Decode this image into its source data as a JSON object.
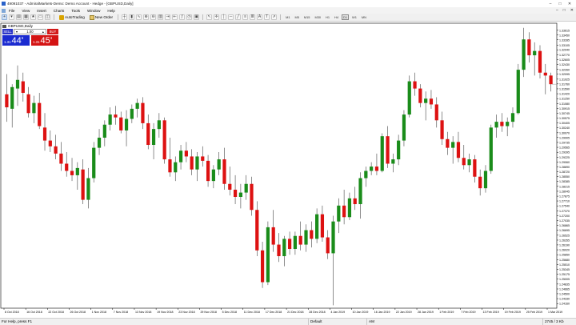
{
  "window": {
    "title": "49091037 - AdmiralMarkets-Demo: Demo Account - Hedge - [GBPUSD,Daily]",
    "controls": [
      "–",
      "□",
      "✕"
    ]
  },
  "menu": {
    "items": [
      "File",
      "View",
      "Insert",
      "Charts",
      "Tools",
      "Window",
      "Help"
    ],
    "right_controls": [
      "–",
      "□",
      "✕"
    ]
  },
  "toolbar": {
    "auto_trading_label": "AutoTrading",
    "new_order_label": "New Order",
    "timeframes": [
      "M1",
      "M5",
      "M15",
      "M30",
      "H1",
      "H4",
      "D1",
      "W1",
      "MN"
    ],
    "active_timeframe": "D1"
  },
  "chart": {
    "caption": "GBPUSD,Daily",
    "trade_panel": {
      "sell_label": "SELL",
      "buy_label": "BUY",
      "lot_value": "1.00",
      "sell_prefix": "1.31",
      "sell_big": "44",
      "sell_sup": "6",
      "buy_prefix": "1.31",
      "buy_big": "45",
      "buy_sup": "3"
    }
  },
  "chart_data": {
    "type": "candlestick",
    "symbol": "GBPUSD",
    "timeframe": "Daily",
    "ylim": [
      1.24,
      1.3386
    ],
    "price_labels": [
      "1.33615",
      "1.33450",
      "1.33285",
      "1.33105",
      "1.32940",
      "1.32770",
      "1.32605",
      "1.32430",
      "1.32260",
      "1.32095",
      "1.31925",
      "1.31760",
      "1.31590",
      "1.31420",
      "1.31250",
      "1.31080",
      "1.30915",
      "1.30745",
      "1.30575",
      "1.30405",
      "1.30240",
      "1.30070",
      "1.29905",
      "1.29735",
      "1.29565",
      "1.29395",
      "1.29225",
      "1.29060",
      "1.28890",
      "1.28720",
      "1.28550",
      "1.28385",
      "1.28215",
      "1.28045",
      "1.27875",
      "1.27710",
      "1.27540",
      "1.27370",
      "1.27200",
      "1.27035",
      "1.26865",
      "1.26695",
      "1.26525",
      "1.26355",
      "1.26190",
      "1.26020",
      "1.25850",
      "1.25680",
      "1.25510",
      "1.25345",
      "1.25175",
      "1.25005",
      "1.24835",
      "1.24665",
      "1.24500",
      "1.24330",
      "1.24160"
    ],
    "date_labels": [
      "8 Oct 2018",
      "16 Oct 2018",
      "22 Oct 2018",
      "26 Oct 2018",
      "1 Nov 2018",
      "7 Nov 2018",
      "13 Nov 2018",
      "19 Nov 2018",
      "23 Nov 2018",
      "29 Nov 2018",
      "5 Dec 2018",
      "11 Dec 2018",
      "17 Dec 2018",
      "21 Dec 2018",
      "28 Dec 2018",
      "4 Jan 2019",
      "10 Jan 2019",
      "16 Jan 2019",
      "22 Jan 2019",
      "28 Jan 2019",
      "1 Feb 2019",
      "7 Feb 2019",
      "13 Feb 2019",
      "19 Feb 2019",
      "25 Feb 2019",
      "1 Mar 2019"
    ],
    "candles": [
      {
        "o": 1.314,
        "h": 1.321,
        "l": 1.3045,
        "c": 1.3095
      },
      {
        "o": 1.309,
        "h": 1.3175,
        "l": 1.3025,
        "c": 1.3165
      },
      {
        "o": 1.316,
        "h": 1.324,
        "l": 1.31,
        "c": 1.319
      },
      {
        "o": 1.3185,
        "h": 1.3215,
        "l": 1.3115,
        "c": 1.3145
      },
      {
        "o": 1.314,
        "h": 1.3165,
        "l": 1.306,
        "c": 1.3075
      },
      {
        "o": 1.3075,
        "h": 1.3135,
        "l": 1.304,
        "c": 1.311
      },
      {
        "o": 1.311,
        "h": 1.3145,
        "l": 1.302,
        "c": 1.303
      },
      {
        "o": 1.3025,
        "h": 1.3075,
        "l": 1.2945,
        "c": 1.298
      },
      {
        "o": 1.298,
        "h": 1.3015,
        "l": 1.294,
        "c": 1.296
      },
      {
        "o": 1.296,
        "h": 1.3,
        "l": 1.2915,
        "c": 1.2935
      },
      {
        "o": 1.2935,
        "h": 1.2975,
        "l": 1.2875,
        "c": 1.29
      },
      {
        "o": 1.29,
        "h": 1.294,
        "l": 1.2855,
        "c": 1.2875
      },
      {
        "o": 1.2875,
        "h": 1.292,
        "l": 1.284,
        "c": 1.286
      },
      {
        "o": 1.286,
        "h": 1.2905,
        "l": 1.281,
        "c": 1.2885
      },
      {
        "o": 1.288,
        "h": 1.2915,
        "l": 1.276,
        "c": 1.2775
      },
      {
        "o": 1.2775,
        "h": 1.2885,
        "l": 1.2745,
        "c": 1.285
      },
      {
        "o": 1.285,
        "h": 1.2975,
        "l": 1.2835,
        "c": 1.2955
      },
      {
        "o": 1.2955,
        "h": 1.302,
        "l": 1.293,
        "c": 1.299
      },
      {
        "o": 1.299,
        "h": 1.305,
        "l": 1.296,
        "c": 1.3035
      },
      {
        "o": 1.3035,
        "h": 1.3095,
        "l": 1.3015,
        "c": 1.307
      },
      {
        "o": 1.307,
        "h": 1.31,
        "l": 1.3035,
        "c": 1.306
      },
      {
        "o": 1.306,
        "h": 1.308,
        "l": 1.3005,
        "c": 1.3015
      },
      {
        "o": 1.3015,
        "h": 1.3085,
        "l": 1.296,
        "c": 1.3055
      },
      {
        "o": 1.3055,
        "h": 1.3105,
        "l": 1.304,
        "c": 1.309
      },
      {
        "o": 1.309,
        "h": 1.3125,
        "l": 1.306,
        "c": 1.311
      },
      {
        "o": 1.311,
        "h": 1.313,
        "l": 1.302,
        "c": 1.304
      },
      {
        "o": 1.304,
        "h": 1.307,
        "l": 1.295,
        "c": 1.2965
      },
      {
        "o": 1.2965,
        "h": 1.304,
        "l": 1.2915,
        "c": 1.302
      },
      {
        "o": 1.302,
        "h": 1.3075,
        "l": 1.299,
        "c": 1.305
      },
      {
        "o": 1.305,
        "h": 1.306,
        "l": 1.29,
        "c": 1.2915
      },
      {
        "o": 1.2915,
        "h": 1.299,
        "l": 1.2855,
        "c": 1.287
      },
      {
        "o": 1.287,
        "h": 1.2925,
        "l": 1.284,
        "c": 1.2905
      },
      {
        "o": 1.2905,
        "h": 1.2965,
        "l": 1.288,
        "c": 1.2945
      },
      {
        "o": 1.2945,
        "h": 1.2975,
        "l": 1.2905,
        "c": 1.2925
      },
      {
        "o": 1.2925,
        "h": 1.295,
        "l": 1.286,
        "c": 1.288
      },
      {
        "o": 1.288,
        "h": 1.294,
        "l": 1.284,
        "c": 1.2925
      },
      {
        "o": 1.2925,
        "h": 1.296,
        "l": 1.289,
        "c": 1.291
      },
      {
        "o": 1.291,
        "h": 1.293,
        "l": 1.282,
        "c": 1.284
      },
      {
        "o": 1.284,
        "h": 1.2895,
        "l": 1.2815,
        "c": 1.288
      },
      {
        "o": 1.288,
        "h": 1.294,
        "l": 1.286,
        "c": 1.2915
      },
      {
        "o": 1.2915,
        "h": 1.2955,
        "l": 1.281,
        "c": 1.283
      },
      {
        "o": 1.283,
        "h": 1.289,
        "l": 1.279,
        "c": 1.281
      },
      {
        "o": 1.281,
        "h": 1.286,
        "l": 1.276,
        "c": 1.2785
      },
      {
        "o": 1.2785,
        "h": 1.283,
        "l": 1.2745,
        "c": 1.28
      },
      {
        "o": 1.28,
        "h": 1.286,
        "l": 1.2775,
        "c": 1.283
      },
      {
        "o": 1.283,
        "h": 1.2855,
        "l": 1.272,
        "c": 1.274
      },
      {
        "o": 1.274,
        "h": 1.277,
        "l": 1.258,
        "c": 1.26
      },
      {
        "o": 1.26,
        "h": 1.263,
        "l": 1.247,
        "c": 1.249
      },
      {
        "o": 1.249,
        "h": 1.27,
        "l": 1.248,
        "c": 1.268
      },
      {
        "o": 1.268,
        "h": 1.274,
        "l": 1.2595,
        "c": 1.262
      },
      {
        "o": 1.262,
        "h": 1.266,
        "l": 1.256,
        "c": 1.258
      },
      {
        "o": 1.258,
        "h": 1.265,
        "l": 1.2545,
        "c": 1.264
      },
      {
        "o": 1.264,
        "h": 1.2665,
        "l": 1.2585,
        "c": 1.2605
      },
      {
        "o": 1.2605,
        "h": 1.2665,
        "l": 1.2585,
        "c": 1.265
      },
      {
        "o": 1.265,
        "h": 1.27,
        "l": 1.26,
        "c": 1.262
      },
      {
        "o": 1.262,
        "h": 1.269,
        "l": 1.2595,
        "c": 1.267
      },
      {
        "o": 1.267,
        "h": 1.27,
        "l": 1.261,
        "c": 1.264
      },
      {
        "o": 1.264,
        "h": 1.2745,
        "l": 1.2625,
        "c": 1.2725
      },
      {
        "o": 1.2725,
        "h": 1.2755,
        "l": 1.263,
        "c": 1.2645
      },
      {
        "o": 1.2645,
        "h": 1.267,
        "l": 1.257,
        "c": 1.259
      },
      {
        "o": 1.259,
        "h": 1.272,
        "l": 1.241,
        "c": 1.27
      },
      {
        "o": 1.27,
        "h": 1.278,
        "l": 1.266,
        "c": 1.2755
      },
      {
        "o": 1.2755,
        "h": 1.281,
        "l": 1.269,
        "c": 1.2715
      },
      {
        "o": 1.2715,
        "h": 1.28,
        "l": 1.2705,
        "c": 1.278
      },
      {
        "o": 1.278,
        "h": 1.282,
        "l": 1.274,
        "c": 1.276
      },
      {
        "o": 1.276,
        "h": 1.287,
        "l": 1.271,
        "c": 1.285
      },
      {
        "o": 1.285,
        "h": 1.289,
        "l": 1.282,
        "c": 1.2875
      },
      {
        "o": 1.2875,
        "h": 1.2905,
        "l": 1.286,
        "c": 1.289
      },
      {
        "o": 1.289,
        "h": 1.2935,
        "l": 1.286,
        "c": 1.2875
      },
      {
        "o": 1.2875,
        "h": 1.3005,
        "l": 1.287,
        "c": 1.2995
      },
      {
        "o": 1.2995,
        "h": 1.303,
        "l": 1.2885,
        "c": 1.29
      },
      {
        "o": 1.29,
        "h": 1.2935,
        "l": 1.287,
        "c": 1.2915
      },
      {
        "o": 1.2915,
        "h": 1.3,
        "l": 1.2895,
        "c": 1.298
      },
      {
        "o": 1.298,
        "h": 1.3085,
        "l": 1.296,
        "c": 1.307
      },
      {
        "o": 1.307,
        "h": 1.3205,
        "l": 1.306,
        "c": 1.3185
      },
      {
        "o": 1.3185,
        "h": 1.3215,
        "l": 1.3135,
        "c": 1.316
      },
      {
        "o": 1.316,
        "h": 1.3175,
        "l": 1.3095,
        "c": 1.311
      },
      {
        "o": 1.311,
        "h": 1.315,
        "l": 1.305,
        "c": 1.3125
      },
      {
        "o": 1.3125,
        "h": 1.3155,
        "l": 1.309,
        "c": 1.3105
      },
      {
        "o": 1.3105,
        "h": 1.313,
        "l": 1.3025,
        "c": 1.305
      },
      {
        "o": 1.305,
        "h": 1.308,
        "l": 1.2965,
        "c": 1.2985
      },
      {
        "o": 1.2985,
        "h": 1.301,
        "l": 1.293,
        "c": 1.2955
      },
      {
        "o": 1.2955,
        "h": 1.2995,
        "l": 1.29,
        "c": 1.2975
      },
      {
        "o": 1.2975,
        "h": 1.301,
        "l": 1.2905,
        "c": 1.292
      },
      {
        "o": 1.292,
        "h": 1.2965,
        "l": 1.288,
        "c": 1.2895
      },
      {
        "o": 1.2895,
        "h": 1.2935,
        "l": 1.287,
        "c": 1.2915
      },
      {
        "o": 1.2915,
        "h": 1.293,
        "l": 1.2835,
        "c": 1.2855
      },
      {
        "o": 1.2855,
        "h": 1.288,
        "l": 1.279,
        "c": 1.2815
      },
      {
        "o": 1.2815,
        "h": 1.2895,
        "l": 1.28,
        "c": 1.2875
      },
      {
        "o": 1.2875,
        "h": 1.3035,
        "l": 1.2865,
        "c": 1.3025
      },
      {
        "o": 1.3025,
        "h": 1.307,
        "l": 1.299,
        "c": 1.3045
      },
      {
        "o": 1.3045,
        "h": 1.3075,
        "l": 1.301,
        "c": 1.303
      },
      {
        "o": 1.303,
        "h": 1.306,
        "l": 1.2995,
        "c": 1.3045
      },
      {
        "o": 1.3045,
        "h": 1.3095,
        "l": 1.3025,
        "c": 1.3075
      },
      {
        "o": 1.3075,
        "h": 1.3245,
        "l": 1.307,
        "c": 1.3225
      },
      {
        "o": 1.3225,
        "h": 1.337,
        "l": 1.32,
        "c": 1.333
      },
      {
        "o": 1.333,
        "h": 1.3355,
        "l": 1.325,
        "c": 1.3275
      },
      {
        "o": 1.3275,
        "h": 1.332,
        "l": 1.3205,
        "c": 1.329
      },
      {
        "o": 1.329,
        "h": 1.331,
        "l": 1.3195,
        "c": 1.3215
      },
      {
        "o": 1.3215,
        "h": 1.3245,
        "l": 1.314,
        "c": 1.3205
      },
      {
        "o": 1.3205,
        "h": 1.3215,
        "l": 1.315,
        "c": 1.3175
      }
    ],
    "bull_color": "#1a8c1a",
    "bear_color": "#dd1111",
    "grid": false
  },
  "statusbar": {
    "help": "For Help, press F1",
    "profile": "Default",
    "time": "AM",
    "traffic": "2745 / 3 Kb"
  }
}
